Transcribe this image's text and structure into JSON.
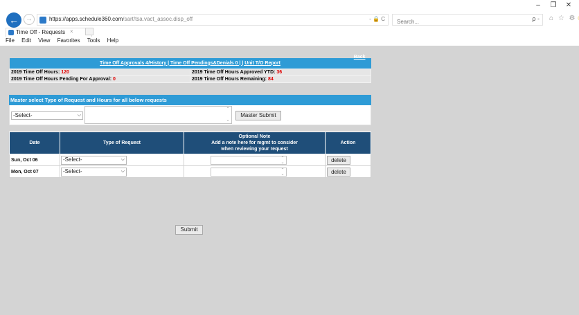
{
  "browser": {
    "back_glyph": "←",
    "forward_glyph": "→",
    "url_host": "https://apps.schedule360.com",
    "url_path": "/sart/tsa.vact_assoc.disp_off",
    "address_controls": "- 🔒 C",
    "search_placeholder": "Search...",
    "search_glyph": "ρ -",
    "toolbar_icons": "⌂ ☆ ⚙",
    "smiley": "☺",
    "window_minimize": "–",
    "window_restore": "❐",
    "window_close": "✕",
    "tab_title": "Time Off - Requests",
    "tab_close": "×",
    "menu": [
      "File",
      "Edit",
      "View",
      "Favorites",
      "Tools",
      "Help"
    ]
  },
  "summary": {
    "links_text": "Time Off Approvals 4/History | Time Off Pendings&Denials 0 | | Unit T/O Report",
    "back_label": "Back",
    "hours_label": "2019 Time Off Hours:",
    "hours_value": "120",
    "approved_label": "2019 Time Off Hours Approved YTD:",
    "approved_value": "36",
    "pending_label": "2019 Time Off Hours Pending For Approval:",
    "pending_value": "0",
    "remaining_label": "2019 Time Off Hours Remaining:",
    "remaining_value": "84"
  },
  "master": {
    "heading": "Master select Type of Request and Hours for all below requests",
    "select_value": "-Select-",
    "submit_label": "Master Submit"
  },
  "table": {
    "headers": {
      "date": "Date",
      "type": "Type of Request",
      "note_line1": "Optional Note",
      "note_line2": "Add a note here for mgmt to consider",
      "note_line3": "when reviewing your request",
      "action": "Action"
    },
    "rows": [
      {
        "date": "Sun, Oct 06",
        "type": "-Select-",
        "action": "delete"
      },
      {
        "date": "Mon, Oct 07",
        "type": "-Select-",
        "action": "delete"
      }
    ]
  },
  "submit_label": "Submit",
  "colors": {
    "header_blue": "#2e9bd6",
    "table_header_navy": "#1f4e79",
    "value_red": "#e00000",
    "page_gray": "#d4d4d4"
  }
}
